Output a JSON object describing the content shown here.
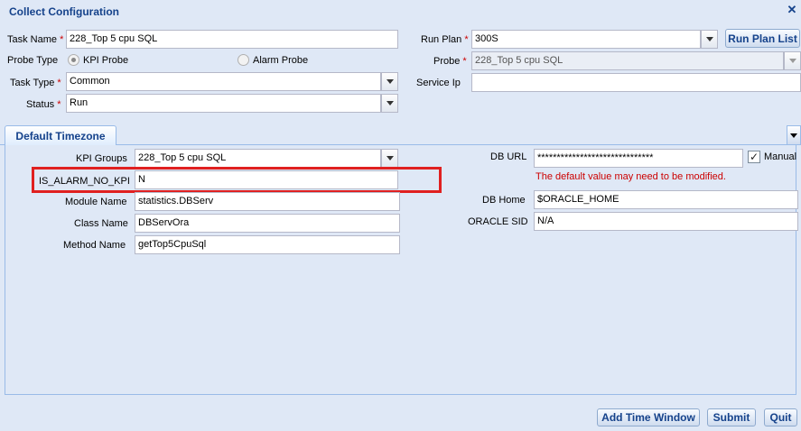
{
  "dialog": {
    "title": "Collect Configuration",
    "close_icon": "close-icon"
  },
  "form": {
    "task_name": {
      "label": "Task Name",
      "value": "228_Top 5 cpu SQL"
    },
    "probe_type": {
      "label": "Probe Type",
      "options": [
        "KPI Probe",
        "Alarm Probe"
      ],
      "selected": "KPI Probe"
    },
    "task_type": {
      "label": "Task Type",
      "value": "Common"
    },
    "status": {
      "label": "Status",
      "value": "Run"
    },
    "run_plan": {
      "label": "Run Plan",
      "value": "300S",
      "button": "Run Plan List"
    },
    "probe": {
      "label": "Probe",
      "value": "228_Top 5 cpu SQL"
    },
    "service_ip": {
      "label": "Service Ip",
      "value": ""
    }
  },
  "tab": {
    "label": "Default Timezone"
  },
  "params": {
    "kpi_groups": {
      "label": "KPI Groups",
      "value": "228_Top 5 cpu SQL"
    },
    "is_alarm_no_kpi": {
      "label": "IS_ALARM_NO_KPI",
      "value": "N"
    },
    "module_name": {
      "label": "Module Name",
      "value": "statistics.DBServ"
    },
    "class_name": {
      "label": "Class Name",
      "value": "DBServOra"
    },
    "method_name": {
      "label": "Method Name",
      "value": "getTop5CpuSql"
    },
    "db_url": {
      "label": "DB URL",
      "value": "******************************",
      "manual_label": "Manual",
      "manual_checked": true,
      "warning": "The default value may need to be modified."
    },
    "db_home": {
      "label": "DB Home",
      "value": "$ORACLE_HOME"
    },
    "oracle_sid": {
      "label": "ORACLE SID",
      "value": "N/A"
    }
  },
  "footer": {
    "add_time_window": "Add Time Window",
    "submit": "Submit",
    "quit": "Quit"
  },
  "colors": {
    "accent": "#15428b",
    "required": "#cc0000",
    "highlight": "#e02020",
    "background": "#dfe8f6"
  }
}
